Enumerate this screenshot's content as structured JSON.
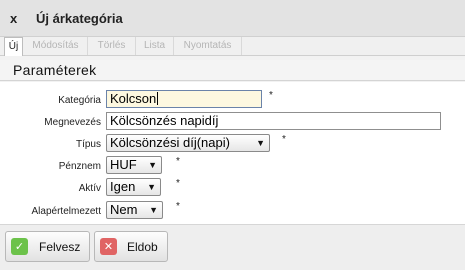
{
  "window": {
    "close_label": "x",
    "title": "Új árkategória"
  },
  "tabs": [
    {
      "label": "Új",
      "active": true
    },
    {
      "label": "Módosítás",
      "active": false
    },
    {
      "label": "Törlés",
      "active": false
    },
    {
      "label": "Lista",
      "active": false
    },
    {
      "label": "Nyomtatás",
      "active": false
    }
  ],
  "section": {
    "title": "Paraméterek"
  },
  "form": {
    "kategoria": {
      "label": "Kategória",
      "value": "Kolcson",
      "required": "*"
    },
    "megnevezes": {
      "label": "Megnevezés",
      "value": "Kölcsönzés napidíj"
    },
    "tipus": {
      "label": "Típus",
      "value": "Kölcsönzési díj(napi)",
      "required": "*"
    },
    "penznem": {
      "label": "Pénznem",
      "value": "HUF",
      "required": "*"
    },
    "aktiv": {
      "label": "Aktív",
      "value": "Igen",
      "required": "*"
    },
    "alapertelmezett": {
      "label": "Alapértelmezett",
      "value": "Nem",
      "required": "*"
    }
  },
  "footer": {
    "save_label": "Felvesz",
    "cancel_label": "Eldob"
  },
  "colors": {
    "save_icon": "#6cc24a",
    "cancel_icon": "#e06464"
  }
}
